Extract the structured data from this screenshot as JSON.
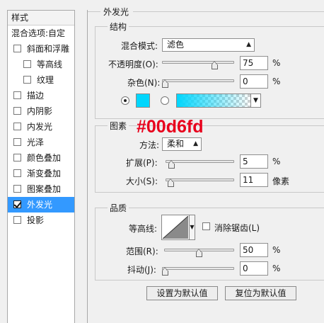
{
  "sidebar": {
    "header": "样式",
    "blend_options": "混合选项:自定",
    "items": [
      {
        "label": "斜面和浮雕",
        "checked": false
      },
      {
        "label": "等高线",
        "checked": false
      },
      {
        "label": "纹理",
        "checked": false
      },
      {
        "label": "描边",
        "checked": false
      },
      {
        "label": "内阴影",
        "checked": false
      },
      {
        "label": "内发光",
        "checked": false
      },
      {
        "label": "光泽",
        "checked": false
      },
      {
        "label": "颜色叠加",
        "checked": false
      },
      {
        "label": "渐变叠加",
        "checked": false
      },
      {
        "label": "图案叠加",
        "checked": false
      },
      {
        "label": "外发光",
        "checked": true
      },
      {
        "label": "投影",
        "checked": false
      }
    ]
  },
  "panel": {
    "title": "外发光",
    "structure": {
      "title": "结构",
      "blend_mode_label": "混合模式:",
      "blend_mode_value": "滤色",
      "opacity_label": "不透明度(O):",
      "opacity_value": "75",
      "opacity_percent": 75,
      "noise_label": "杂色(N):",
      "noise_value": "0",
      "noise_percent": 0,
      "percent_sign": "%"
    },
    "elements": {
      "title": "图素",
      "method_label": "方法:",
      "method_value": "柔和",
      "spread_label": "扩展(P):",
      "spread_value": "5",
      "spread_percent": 5,
      "size_label": "大小(S):",
      "size_value": "11",
      "size_unit": "像素",
      "percent_sign": "%"
    },
    "quality": {
      "title": "品质",
      "contour_label": "等高线:",
      "antialias_label": "消除锯齿(L)",
      "range_label": "范围(R):",
      "range_value": "50",
      "range_percent": 50,
      "jitter_label": "抖动(J):",
      "jitter_value": "0",
      "jitter_percent": 0,
      "percent_sign": "%"
    },
    "buttons": {
      "make_default": "设置为默认值",
      "reset_default": "复位为默认值"
    }
  },
  "annotation": {
    "hex": "#00d6fd"
  },
  "colors": {
    "glow": "#00d6fd",
    "selection": "#3399ff",
    "annotation": "#e8001c"
  }
}
